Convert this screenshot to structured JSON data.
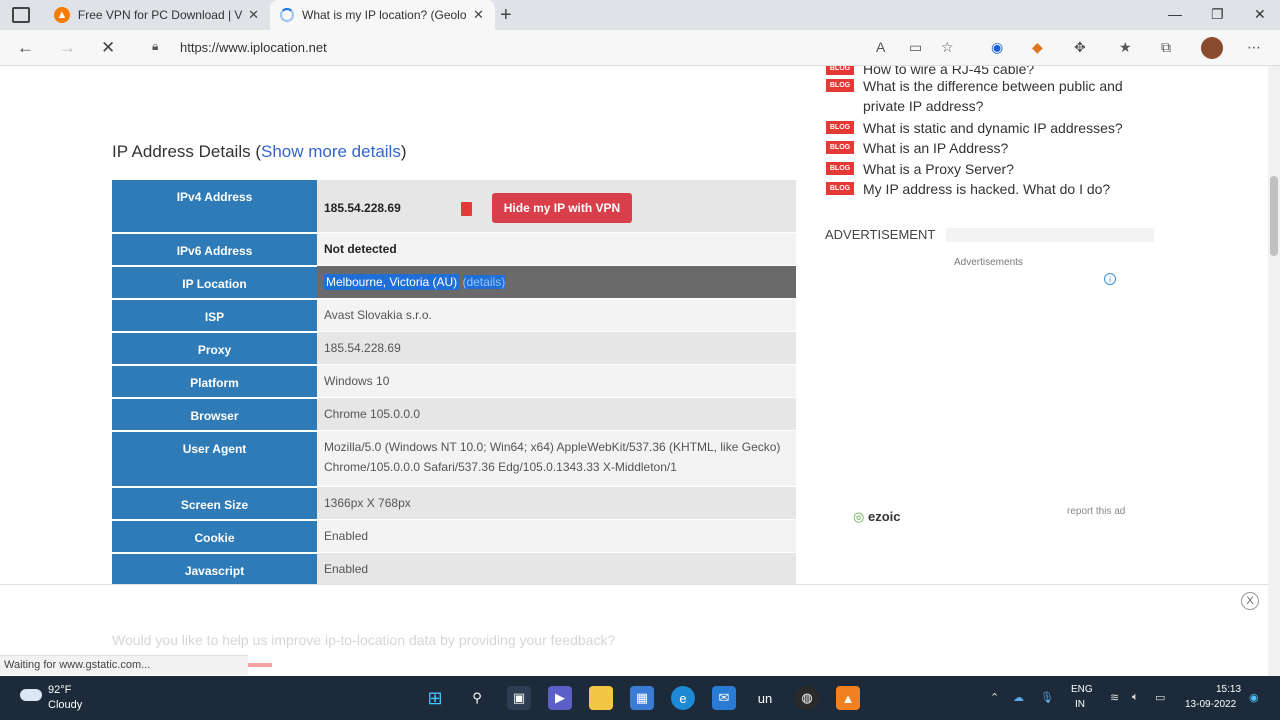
{
  "browser": {
    "tabs": [
      {
        "title": "Free VPN for PC Download | VPN",
        "favicon": "vpn-logo-icon"
      },
      {
        "title": "What is my IP location? (Geoloca",
        "favicon": "loading-spinner-icon",
        "active": true
      }
    ],
    "url": "https://www.iplocation.net"
  },
  "page": {
    "section_title": "IP Address Details (",
    "section_link": "Show more details",
    "section_close": ")",
    "rows": [
      {
        "label": "IPv4 Address",
        "value": "185.54.228.69"
      },
      {
        "label": "IPv6 Address",
        "value": "Not detected"
      },
      {
        "label": "IP Location",
        "value": "Melbourne, Victoria (AU)",
        "link": "(details)"
      },
      {
        "label": "ISP",
        "value": "Avast Slovakia s.r.o."
      },
      {
        "label": "Proxy",
        "value": "185.54.228.69"
      },
      {
        "label": "Platform",
        "value": "Windows 10"
      },
      {
        "label": "Browser",
        "value": "Chrome 105.0.0.0"
      },
      {
        "label": "User Agent",
        "value": "Mozilla/5.0 (Windows NT 10.0; Win64; x64) AppleWebKit/537.36 (KHTML, like Gecko) Chrome/105.0.0.0 Safari/537.36 Edg/105.0.1343.33 X-Middleton/1"
      },
      {
        "label": "Screen Size",
        "value": "1366px X 768px"
      },
      {
        "label": "Cookie",
        "value": "Enabled"
      },
      {
        "label": "Javascript",
        "value": "Enabled"
      }
    ],
    "vpn_button": "Hide my IP with VPN",
    "feedback": "Would you like to help us improve ip-to-location data by providing your feedback?"
  },
  "sidebar": {
    "badge": "BLOG",
    "items": [
      "How to wire a RJ-45 cable?",
      "What is the difference between public and private IP address?",
      "What is static and dynamic IP addresses?",
      "What is an IP Address?",
      "What is a Proxy Server?",
      "My IP address is hacked. What do I do?"
    ],
    "advertisement": "ADVERTISEMENT",
    "ads_small": "Advertisements",
    "ezoic": "ezoic",
    "report": "report this ad"
  },
  "status_bar": "Waiting for www.gstatic.com...",
  "taskbar": {
    "temperature": "92°F",
    "condition": "Cloudy",
    "lang1": "ENG",
    "lang2": "IN",
    "time": "15:13",
    "date": "13-09-2022"
  },
  "colors": {
    "accent_blue": "#2e7bb8",
    "vpn_red": "#d93f4a",
    "blog_red": "#e53935",
    "link": "#3366cc"
  }
}
